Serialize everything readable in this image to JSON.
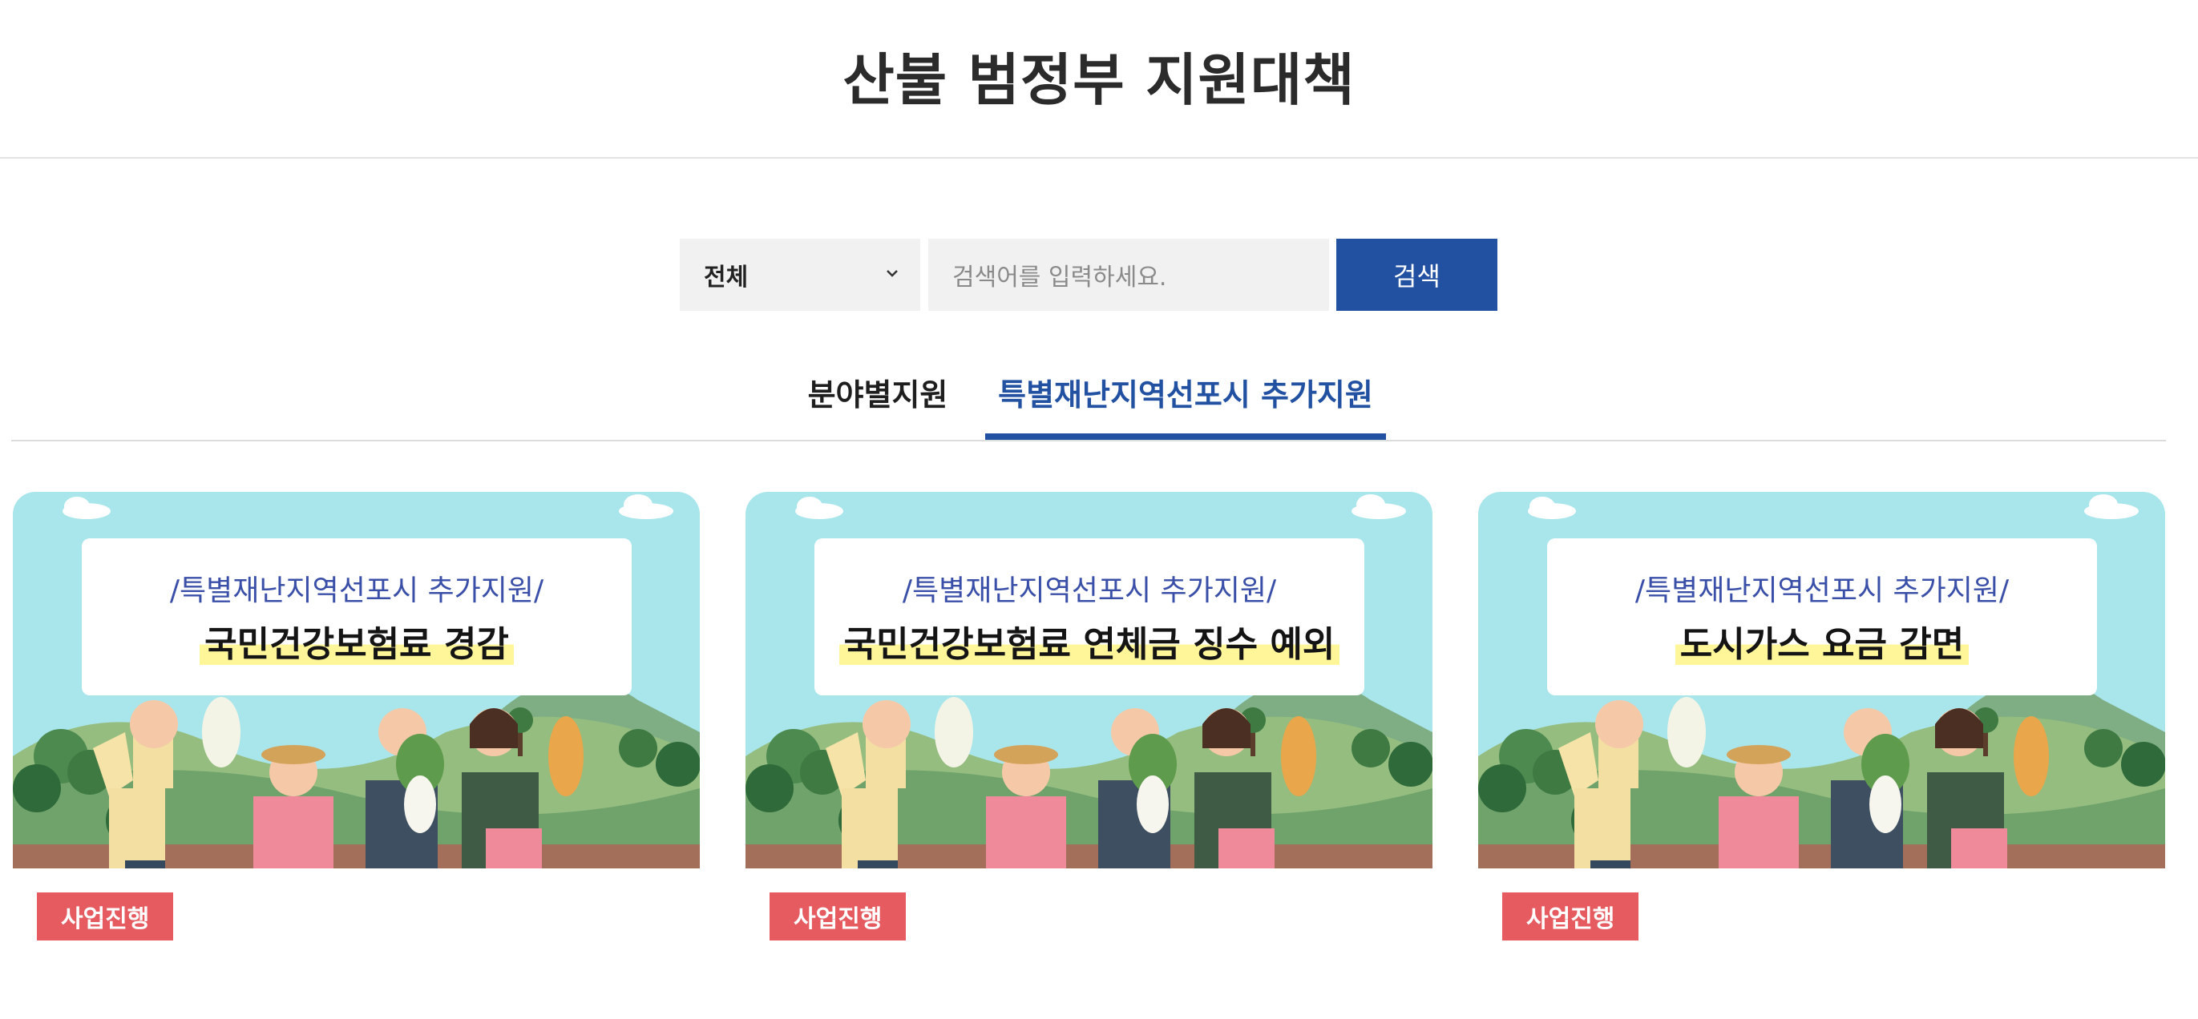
{
  "page": {
    "title": "산불 범정부 지원대책"
  },
  "search": {
    "category_selected": "전체",
    "input_placeholder": "검색어를 입력하세요.",
    "button_label": "검색"
  },
  "tabs": [
    {
      "label": "분야별지원",
      "active": false
    },
    {
      "label": "특별재난지역선포시 추가지원",
      "active": true
    }
  ],
  "cards": [
    {
      "thumb_subtitle": "/특별재난지역선포시 추가지원/",
      "thumb_title": "국민건강보험료 경감",
      "status": "사업진행"
    },
    {
      "thumb_subtitle": "/특별재난지역선포시 추가지원/",
      "thumb_title": "국민건강보험료 연체금 징수 예외",
      "status": "사업진행"
    },
    {
      "thumb_subtitle": "/특별재난지역선포시 추가지원/",
      "thumb_title": "도시가스 요금 감면",
      "status": "사업진행"
    }
  ],
  "colors": {
    "accent": "#2251a2",
    "status_badge": "#e55b60",
    "label_highlight": "#fff69a",
    "sky": "#a9e6ec"
  },
  "icons": {
    "select_arrow": "chevron-down-icon"
  }
}
